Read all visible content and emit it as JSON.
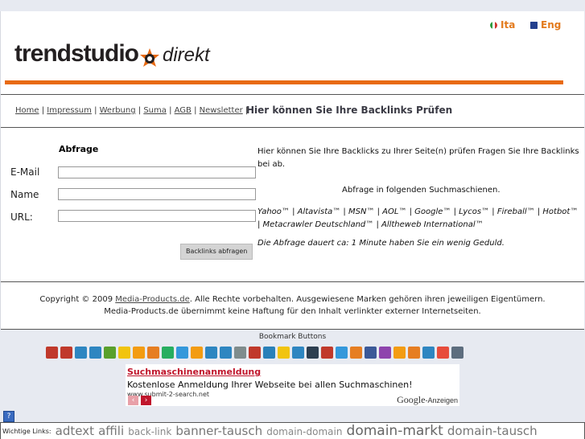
{
  "header": {
    "logo_main": "trendstudio",
    "logo_sub": "direkt",
    "lang_ita": "Ita",
    "lang_eng": "Eng"
  },
  "nav": {
    "links": [
      "Home",
      "Impressum",
      "Werbung",
      "Suma",
      "AGB",
      "Newsletter"
    ],
    "separator": "|",
    "title": "Hier können Sie Ihre Backlinks Prüfen"
  },
  "form": {
    "heading": "Abfrage",
    "email_label": "E-Mail",
    "name_label": "Name",
    "url_label": "URL:",
    "email_value": "",
    "name_value": "",
    "url_value": "",
    "submit_label": "Backlinks abfragen"
  },
  "info": {
    "intro": "Hier können Sie Ihre Backlicks zu Ihrer Seite(n) prüfen Fragen Sie Ihre Backlinks bei ab.",
    "engines_heading": "Abfrage in folgenden Suchmaschienen.",
    "engines": "Yahoo™ | Altavista™ | MSN™ | AOL™ | Google™ | Lycos™ | Fireball™ | Hotbot™ | Metacrawler Deutschland™ | Alltheweb International™",
    "duration": "Die Abfrage dauert ca: 1 Minute haben Sie ein wenig Geduld."
  },
  "footer": {
    "copy_prefix": "Copyright © 2009",
    "copy_link": "Media-Products.de",
    "copy_rest": ". Alle Rechte vorbehalten. Ausgewiesene Marken gehören ihren jeweiligen Eigentümern.",
    "disclaimer": "Media-Products.de übernimmt keine Haftung für den Inhalt verlinkter externer Internetseiten."
  },
  "bookmarks": {
    "title": "Bookmark Buttons",
    "colors": [
      "#c0392b",
      "#c0392b",
      "#2e86c1",
      "#2e86c1",
      "#5aa02c",
      "#f1c40f",
      "#f39c12",
      "#e67e22",
      "#27ae60",
      "#3498db",
      "#f39c12",
      "#2e86c1",
      "#2e86c1",
      "#7f8c8d",
      "#c0392b",
      "#2980b9",
      "#f1c40f",
      "#2e86c1",
      "#2c3e50",
      "#c0392b",
      "#3498db",
      "#e67e22",
      "#3b5998",
      "#8e44ad",
      "#f39c12",
      "#e67e22",
      "#2e86c1",
      "#e74c3c",
      "#5d6d7e"
    ]
  },
  "ad": {
    "title": "Suchmaschinenanmeldung",
    "text": "Kostenlose Anmeldung Ihrer Webseite bei allen Suchmaschinen!",
    "url": "www.submit-2-search.net",
    "prev": "‹",
    "next": "›",
    "google": "Google",
    "google_suffix": "-Anzeigen"
  },
  "help_icon": "?",
  "links": {
    "label": "Wichtige Links:",
    "items": [
      "adtext",
      "affili",
      "back-link",
      "banner-tausch",
      "domain-domain",
      "domain-markt",
      "domain-tausch"
    ]
  }
}
